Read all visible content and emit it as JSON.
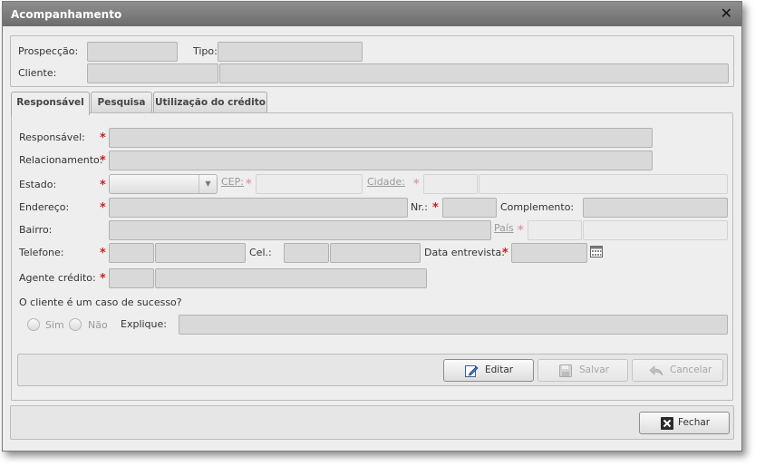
{
  "window": {
    "title": "Acompanhamento"
  },
  "header": {
    "prospeccao_label": "Prospecção:",
    "tipo_label": "Tipo:",
    "cliente_label": "Cliente:"
  },
  "tabs": [
    {
      "label": "Responsável",
      "active": true
    },
    {
      "label": "Pesquisa",
      "active": false
    },
    {
      "label": "Utilização do crédito",
      "active": false
    }
  ],
  "form": {
    "responsavel_label": "Responsável:",
    "relacionamento_label": "Relacionamento:",
    "estado_label": "Estado:",
    "cep_label": "CEP:",
    "cidade_label": "Cidade:",
    "endereco_label": "Endereço:",
    "nr_label": "Nr.:",
    "complemento_label": "Complemento:",
    "bairro_label": "Bairro:",
    "pais_label": "País",
    "telefone_label": "Telefone:",
    "cel_label": "Cel.:",
    "data_entrevista_label": "Data entrevista:",
    "agente_credito_label": "Agente crédito:",
    "sucesso_question": "O cliente é um caso de sucesso?",
    "sim_label": "Sim",
    "nao_label": "Não",
    "explique_label": "Explique:",
    "required_mark": "*"
  },
  "actions": {
    "editar": "Editar",
    "salvar": "Salvar",
    "cancelar": "Cancelar",
    "fechar": "Fechar"
  },
  "icons": {
    "close": "close-icon",
    "edit": "pencil-icon",
    "save": "floppy-disk-icon",
    "cancel": "undo-arrow-icon",
    "fechar": "x-square-icon",
    "calendar": "calendar-icon",
    "dropdown": "chevron-down-icon"
  },
  "colors": {
    "titlebar": "#7d7d7d",
    "required": "#cc2222",
    "field_bg": "#d9d9d9"
  }
}
